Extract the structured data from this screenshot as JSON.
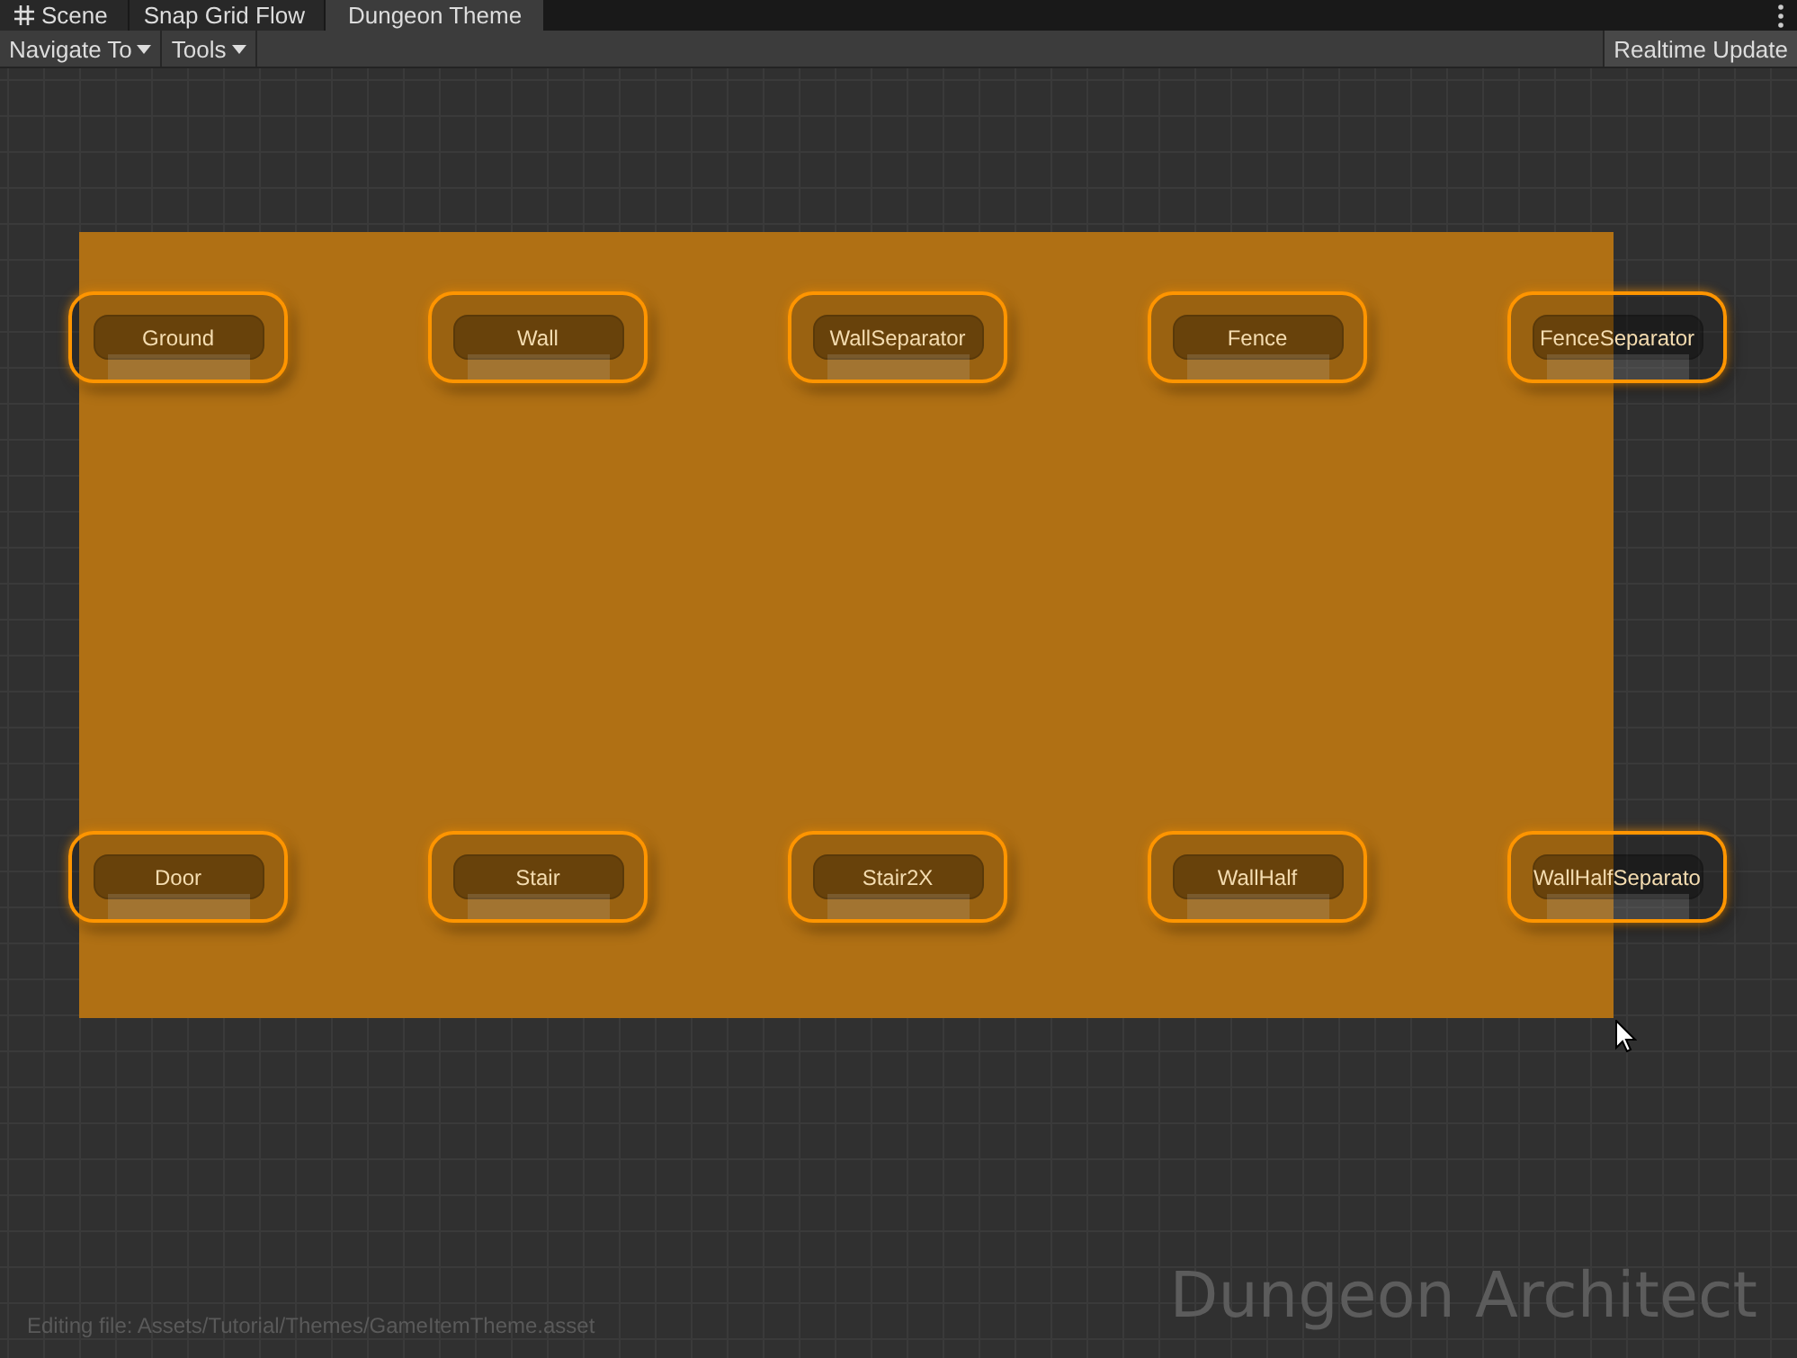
{
  "tabs": [
    {
      "label": "Scene",
      "kind": "icon",
      "selected": false
    },
    {
      "label": "Snap Grid Flow",
      "kind": "plain",
      "selected": false
    },
    {
      "label": "Dungeon Theme",
      "kind": "plain",
      "selected": true
    }
  ],
  "toolbar": {
    "menus": [
      "Navigate To",
      "Tools"
    ],
    "buttons": [
      "Realtime Update"
    ]
  },
  "canvas": {
    "selection_box": true,
    "nodes": [
      {
        "label": "Ground",
        "selected": true
      },
      {
        "label": "Wall",
        "selected": true
      },
      {
        "label": "WallSeparator",
        "selected": true
      },
      {
        "label": "Fence",
        "selected": true
      },
      {
        "label": "FenceSeparator",
        "selected": true
      },
      {
        "label": "Door",
        "selected": true
      },
      {
        "label": "Stair",
        "selected": true
      },
      {
        "label": "Stair2X",
        "selected": true
      },
      {
        "label": "WallHalf",
        "selected": true
      },
      {
        "label": "WallHalfSeparato",
        "selected": true
      }
    ],
    "status": "Editing file: Assets/Tutorial/Themes/GameItemTheme.asset",
    "watermark": "Dungeon Architect"
  }
}
